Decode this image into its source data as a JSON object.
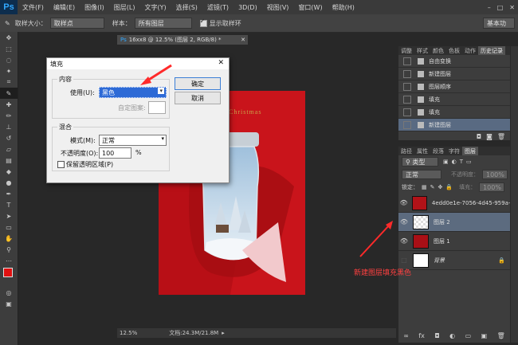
{
  "app": {
    "logo": "Ps"
  },
  "menu": [
    "文件(F)",
    "编辑(E)",
    "图像(I)",
    "图层(L)",
    "文字(Y)",
    "选择(S)",
    "滤镜(T)",
    "3D(D)",
    "视图(V)",
    "窗口(W)",
    "帮助(H)"
  ],
  "window_label": "基本功",
  "options": {
    "sample_size_label": "取样大小：",
    "sample_size_value": "取样点",
    "sample_label": "样本：",
    "sample_value": "所有图层",
    "show_ring_label": "显示取样环"
  },
  "document": {
    "tab_title": "16xx8 @ 12.5% (图层 2, RGB/8) *",
    "zoom": "12.5%",
    "doc_info": "文档:24.3M/21.8M",
    "poster_text": "Christmas"
  },
  "fill_dialog": {
    "title": "填充",
    "content_group": "内容",
    "use_label": "使用(U):",
    "use_value": "黑色",
    "custom_pattern_label": "自定图案:",
    "blend_group": "混合",
    "mode_label": "模式(M):",
    "mode_value": "正常",
    "opacity_label": "不透明度(O):",
    "opacity_value": "100",
    "opacity_unit": "%",
    "preserve_label": "保留透明区域(P)",
    "ok_label": "确定",
    "cancel_label": "取消"
  },
  "history_panel": {
    "tabs": [
      "调整",
      "样式",
      "颜色",
      "色板",
      "动作",
      "历史记录"
    ],
    "items": [
      "自由变换",
      "新建图层",
      "图层顺序",
      "填充",
      "填充",
      "新建图层"
    ]
  },
  "layers_panel": {
    "tabs": [
      "路径",
      "属性",
      "段落",
      "字符",
      "图层"
    ],
    "filter_label": "类型",
    "blend_mode": "正常",
    "opacity_label": "不透明度：",
    "opacity_value": "100%",
    "lock_label": "锁定：",
    "fill_label": "填充：",
    "fill_value": "100%",
    "layers": [
      {
        "name": "4edd0e1e-7056-4d45-959a-...",
        "color": "#b21218"
      },
      {
        "name": "图层 2",
        "color": "#ffffff"
      },
      {
        "name": "图层 1",
        "color": "#a90f16"
      },
      {
        "name": "背景",
        "color": "#ffffff"
      }
    ]
  },
  "annotation": "新建图层填充黑色",
  "colors": {
    "foreground": "#e01010",
    "background": "#ffffff",
    "accent": "#ff2a2a"
  }
}
